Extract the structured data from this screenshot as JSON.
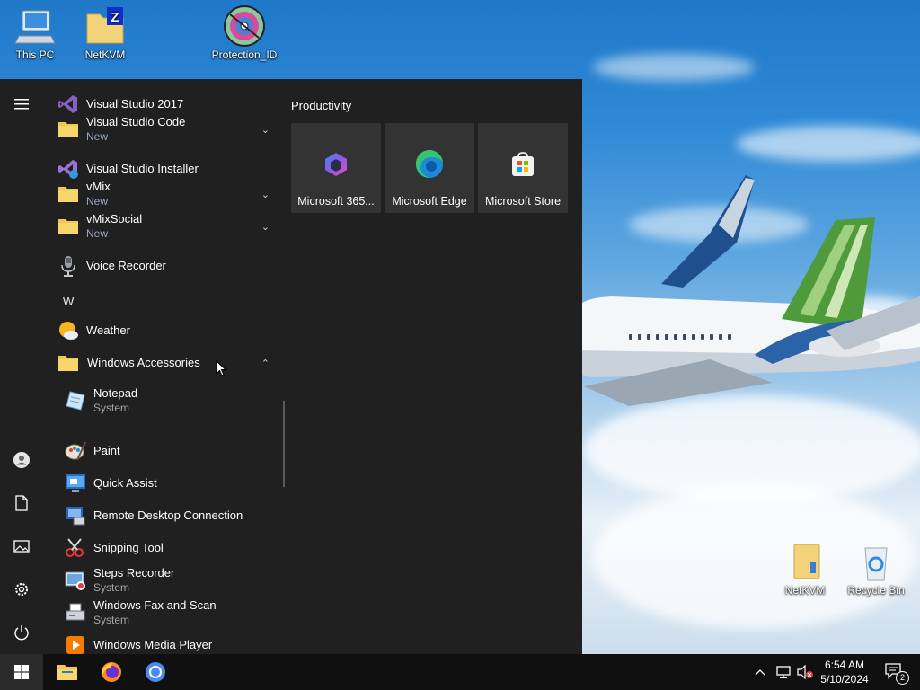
{
  "desktop": {
    "icons_top": [
      {
        "label": "This PC"
      },
      {
        "label": "NetKVM"
      },
      {
        "label": "Protection_ID"
      }
    ],
    "icons_bottom": [
      {
        "label": "NetKVM"
      },
      {
        "label": "Recycle Bin"
      }
    ]
  },
  "start_menu": {
    "rail": {
      "menu_icon": "hamburger-icon",
      "items": [
        "user-icon",
        "documents-icon",
        "pictures-icon",
        "settings-icon",
        "power-icon"
      ]
    },
    "apps": [
      {
        "label": "Visual Studio 2017",
        "icon": "visual-studio-icon"
      },
      {
        "label": "Visual Studio Code",
        "sub": "New",
        "icon": "folder-icon",
        "expand": "⌄"
      },
      {
        "label": "Visual Studio Installer",
        "icon": "vs-installer-icon"
      },
      {
        "label": "vMix",
        "sub": "New",
        "icon": "folder-icon",
        "expand": "⌄"
      },
      {
        "label": "vMixSocial",
        "sub": "New",
        "icon": "folder-icon",
        "expand": "⌄"
      },
      {
        "label": "Voice Recorder",
        "icon": "microphone-icon"
      },
      {
        "letter": "W"
      },
      {
        "label": "Weather",
        "icon": "weather-icon"
      },
      {
        "label": "Windows Accessories",
        "icon": "folder-icon",
        "expand": "⌃"
      },
      {
        "label": "Notepad",
        "sub": "System",
        "icon": "notepad-icon"
      },
      {
        "label": "Paint",
        "icon": "paint-icon"
      },
      {
        "label": "Quick Assist",
        "icon": "quick-assist-icon"
      },
      {
        "label": "Remote Desktop Connection",
        "icon": "remote-desktop-icon"
      },
      {
        "label": "Snipping Tool",
        "icon": "snipping-tool-icon"
      },
      {
        "label": "Steps Recorder",
        "sub": "System",
        "icon": "steps-recorder-icon"
      },
      {
        "label": "Windows Fax and Scan",
        "sub": "System",
        "icon": "fax-scan-icon"
      },
      {
        "label": "Windows Media Player",
        "icon": "media-player-icon"
      }
    ],
    "tile_group": {
      "title": "Productivity",
      "tiles": [
        {
          "label": "Microsoft 365...",
          "icon": "microsoft-365-icon"
        },
        {
          "label": "Microsoft Edge",
          "icon": "edge-icon"
        },
        {
          "label": "Microsoft Store",
          "icon": "store-icon"
        }
      ]
    }
  },
  "taskbar": {
    "pinned": [
      "start-icon",
      "file-explorer-icon",
      "firefox-icon",
      "chrome-icon"
    ],
    "tray": {
      "time": "6:54 AM",
      "date": "5/10/2024",
      "notification_count": "2"
    }
  },
  "colors": {
    "menu_bg": "#202020",
    "tile_bg": "#333333",
    "taskbar_bg": "#101010",
    "new_badge": "#9aa7c8"
  }
}
